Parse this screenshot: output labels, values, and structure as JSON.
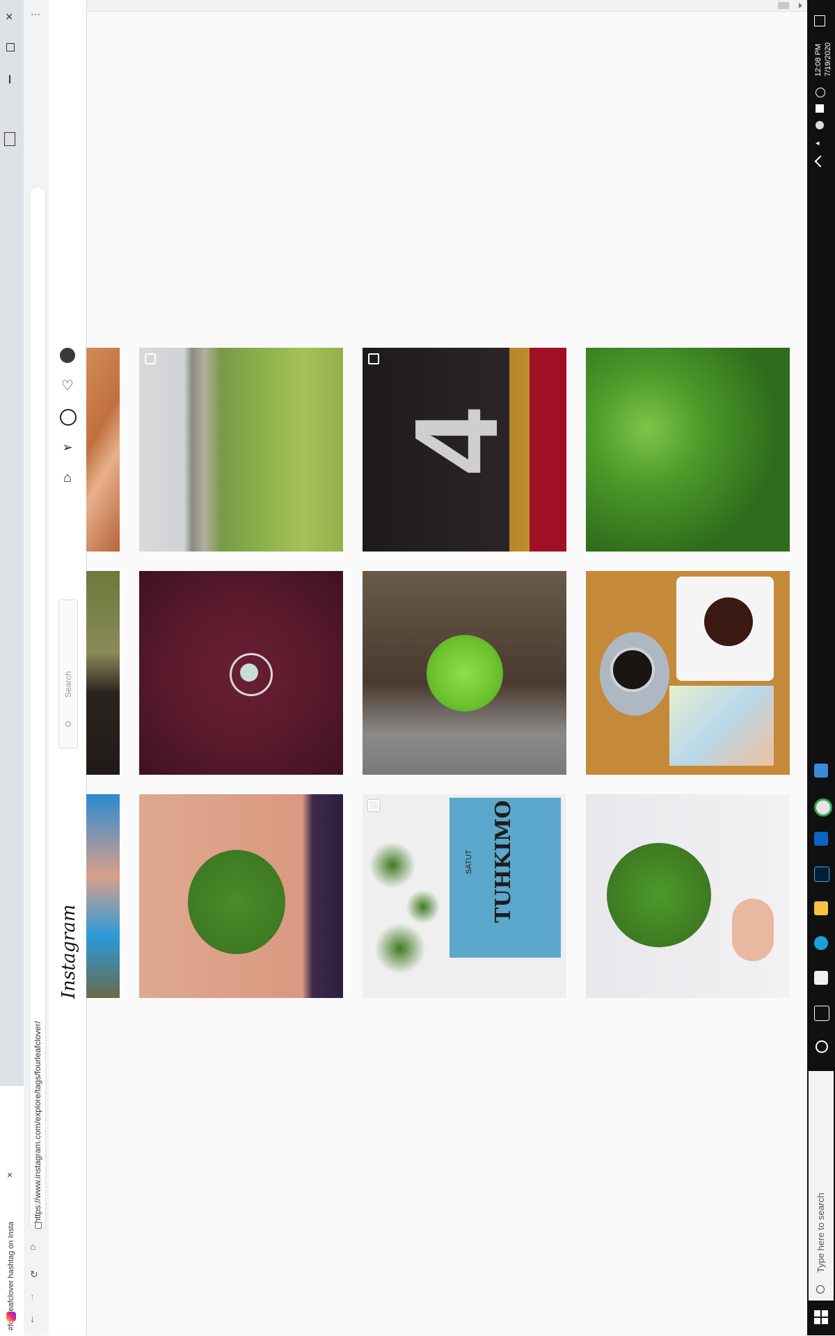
{
  "browser": {
    "tab_title": "#fourleafclover hashtag on Insta",
    "url": "https://www.instagram.com/explore/tags/fourleafclover/",
    "new_tab_symbol": "+",
    "close_symbol": "×"
  },
  "instagram": {
    "logo": "Instagram",
    "search_placeholder": "Search"
  },
  "posts": [
    {
      "id": "p1",
      "desc": "arm tattoo (partial)",
      "multi": false
    },
    {
      "id": "p2",
      "desc": "grass and stone wall",
      "multi": true,
      "icon": "camera"
    },
    {
      "id": "p3",
      "desc": "number 4 on asphalt",
      "multi": true
    },
    {
      "id": "p4",
      "desc": "clover patch",
      "multi": false
    },
    {
      "id": "p5",
      "desc": "partial photo",
      "multi": false
    },
    {
      "id": "p6",
      "desc": "clover pendant on maroon fabric",
      "multi": false
    },
    {
      "id": "p7",
      "desc": "four-leaf clover on wood",
      "multi": false
    },
    {
      "id": "p8",
      "desc": "coffee and cake with book",
      "multi": false
    },
    {
      "id": "p9",
      "desc": "partial photo",
      "multi": false
    },
    {
      "id": "p10",
      "desc": "clover in palm",
      "multi": false
    },
    {
      "id": "p11",
      "desc": "clovers and Tuhkimo book",
      "multi": true,
      "book_title": "TUHKIMO",
      "book_subtitle": "SATUT"
    },
    {
      "id": "p12",
      "desc": "clover held in hand",
      "multi": false
    }
  ],
  "taskbar": {
    "time": "12:08 PM",
    "date": "7/19/2020",
    "search_placeholder": "Type here to search"
  },
  "colors": {
    "ig_bg": "#fafafa",
    "taskbar": "#101010",
    "clover_green": "#4c9a2a"
  }
}
